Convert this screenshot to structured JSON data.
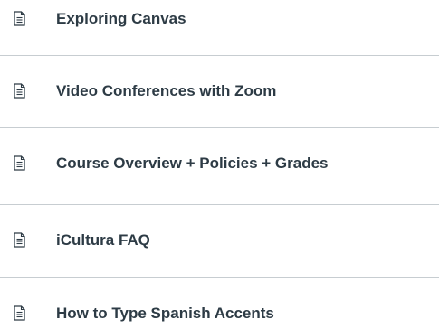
{
  "module_items": [
    {
      "label": "Exploring Canvas",
      "icon": "page-icon"
    },
    {
      "label": "Video Conferences with Zoom",
      "icon": "page-icon"
    },
    {
      "label": "Course Overview + Policies + Grades",
      "icon": "page-icon"
    },
    {
      "label": "iCultura FAQ",
      "icon": "page-icon"
    },
    {
      "label": "How to Type Spanish Accents",
      "icon": "page-icon"
    }
  ],
  "colors": {
    "text": "#2d3b45",
    "icon": "#2d3b45",
    "divider": "#c7cdd1"
  }
}
